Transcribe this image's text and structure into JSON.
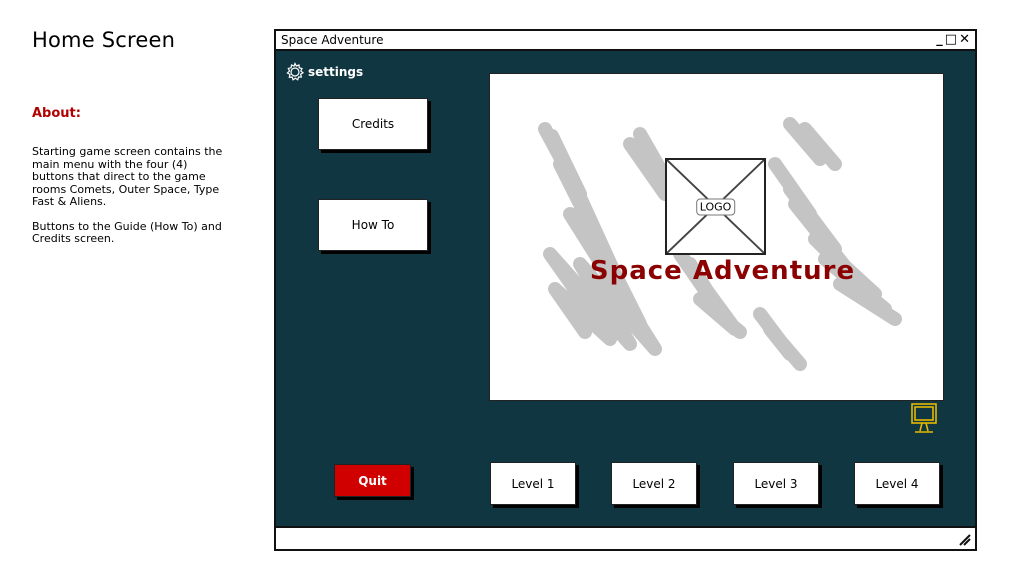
{
  "annotation": {
    "heading": "Home Screen",
    "about_title": "About:",
    "about_paragraph_1": "Starting game screen contains the main menu with the four (4) buttons that direct to the game rooms Comets, Outer Space, Type Fast & Aliens.",
    "about_paragraph_2": "Buttons to the Guide (How To) and Credits screen."
  },
  "window": {
    "title": "Space Adventure",
    "controls": {
      "minimize": "_",
      "maximize": "□",
      "close": "✕"
    }
  },
  "settings": {
    "label": "settings",
    "icon": "gear-icon"
  },
  "menu": {
    "credits_label": "Credits",
    "howto_label": "How To",
    "quit_label": "Quit"
  },
  "display": {
    "logo_label": "LOGO",
    "game_title": "Space Adventure"
  },
  "levels": [
    "Level 1",
    "Level 2",
    "Level 3",
    "Level 4"
  ],
  "colors": {
    "background": "#0f3641",
    "quit_button": "#d10000",
    "title_text": "#8b0000",
    "scribble": "#c4c4c4",
    "monitor_icon": "#e6b800"
  }
}
